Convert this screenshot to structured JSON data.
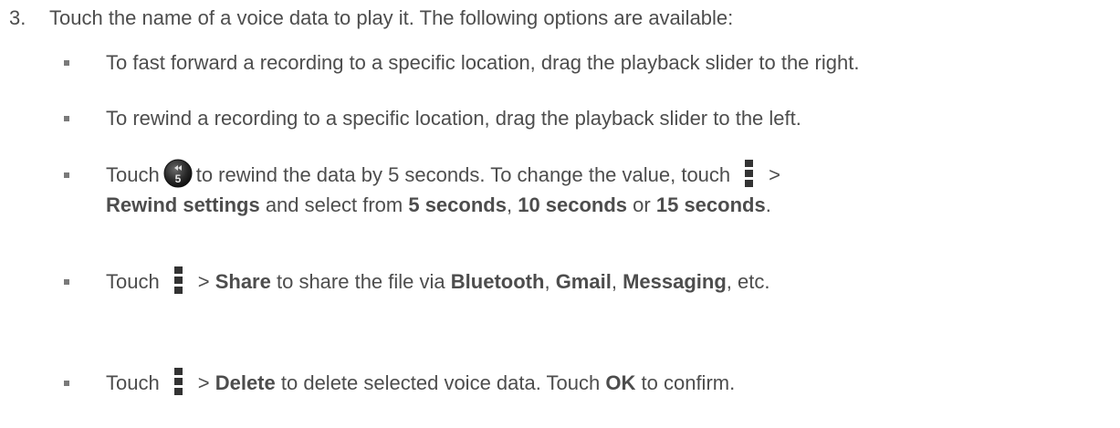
{
  "step": {
    "number": "3.",
    "text": "Touch the name of a voice data to play it. The following options are available:"
  },
  "bullets": {
    "b1": {
      "text": "To fast forward a recording to a specific location, drag the playback slider to the right."
    },
    "b2": {
      "text": "To rewind a recording to a specific location, drag the playback slider to the left."
    },
    "b3": {
      "touch": "Touch",
      "after_icon": "to rewind the data by 5 seconds. To change the value, touch",
      "gt": ">",
      "rewind_settings": "Rewind settings",
      "select_from": "and select from",
      "opt1": "5 seconds",
      "comma1": ",",
      "opt2": "10 seconds",
      "or": "or",
      "opt3": "15 seconds",
      "period": "."
    },
    "b4": {
      "touch": "Touch",
      "gt": ">",
      "share": "Share",
      "mid": "to share the file via",
      "bluetooth": "Bluetooth",
      "comma1": ",",
      "gmail": "Gmail",
      "comma2": ",",
      "messaging": "Messaging",
      "end": ", etc."
    },
    "b5": {
      "touch": "Touch",
      "gt": ">",
      "delete": "Delete",
      "mid": "to delete selected voice data. Touch",
      "ok": "OK",
      "end": "to confirm."
    }
  },
  "icons": {
    "rewind_icon_label": "5",
    "rewind_icon": "rewind-5-seconds-icon",
    "menu_icon": "menu-more-icon"
  }
}
